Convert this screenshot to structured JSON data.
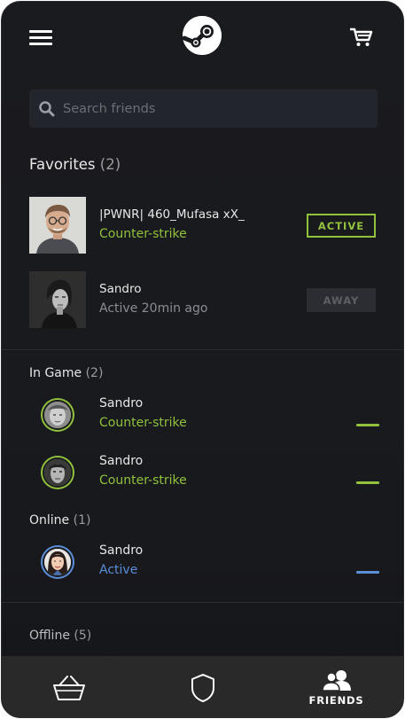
{
  "search": {
    "placeholder": "Search friends"
  },
  "favorites": {
    "title": "Favorites",
    "count": "(2)",
    "items": [
      {
        "name": "|PWNR| 460_Mufasa xX_",
        "status": "Counter-strike",
        "badge": "ACTIVE"
      },
      {
        "name": "Sandro",
        "status": "Active 20min ago",
        "badge": "AWAY"
      }
    ]
  },
  "in_game": {
    "title": "In Game",
    "count": "(2)",
    "items": [
      {
        "name": "Sandro",
        "status": "Counter-strike"
      },
      {
        "name": "Sandro",
        "status": "Counter-strike"
      }
    ]
  },
  "online": {
    "title": "Online",
    "count": "(1)",
    "items": [
      {
        "name": "Sandro",
        "status": "Active"
      }
    ]
  },
  "offline": {
    "title": "Offline",
    "count": "(5)"
  },
  "bottom_nav": {
    "items": [
      {
        "icon": "basket-icon",
        "label": ""
      },
      {
        "icon": "shield-icon",
        "label": ""
      },
      {
        "icon": "friends-icon",
        "label": "FRIENDS"
      }
    ]
  },
  "colors": {
    "accent_green": "#91c13d",
    "accent_blue": "#5b8ed8",
    "away_gray": "#5c5f66",
    "background": "#1a1b1f",
    "nav_background": "#2a2929"
  }
}
